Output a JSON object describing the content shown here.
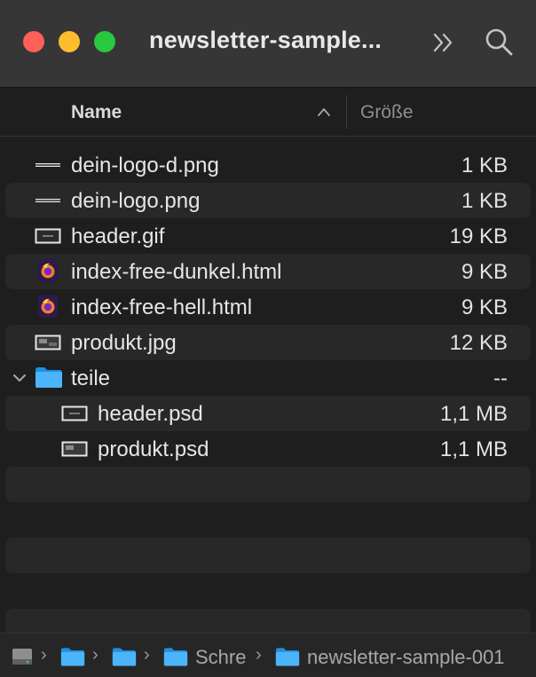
{
  "window": {
    "title": "newsletter-sample..."
  },
  "toolbar": {
    "more_icon": "chevron-double-right-icon",
    "search_icon": "search-icon"
  },
  "columns": {
    "name": "Name",
    "size": "Größe",
    "sort": "ascending"
  },
  "files": [
    {
      "name": "dein-logo-d.png",
      "size": "1 KB",
      "icon": "image-file-icon"
    },
    {
      "name": "dein-logo.png",
      "size": "1 KB",
      "icon": "image-file-icon"
    },
    {
      "name": "header.gif",
      "size": "19 KB",
      "icon": "image-file-icon"
    },
    {
      "name": "index-free-dunkel.html",
      "size": "9 KB",
      "icon": "firefox-html-icon"
    },
    {
      "name": "index-free-hell.html",
      "size": "9 KB",
      "icon": "firefox-html-icon"
    },
    {
      "name": "produkt.jpg",
      "size": "12 KB",
      "icon": "image-file-icon"
    },
    {
      "name": "teile",
      "size": "--",
      "icon": "folder-icon",
      "expanded": true
    },
    {
      "name": "header.psd",
      "size": "1,1 MB",
      "icon": "image-file-icon"
    },
    {
      "name": "produkt.psd",
      "size": "1,1 MB",
      "icon": "image-file-icon"
    }
  ],
  "pathbar": {
    "items": [
      {
        "label": "",
        "icon": "hard-drive-icon"
      },
      {
        "label": "",
        "icon": "folder-icon"
      },
      {
        "label": "",
        "icon": "folder-icon"
      },
      {
        "label": "Schre",
        "icon": "folder-icon"
      },
      {
        "label": "newsletter-sample-001",
        "icon": "folder-icon"
      }
    ],
    "separator": "›"
  },
  "colors": {
    "red": "#fe5f57",
    "yellow": "#febc2e",
    "green": "#28c840",
    "folder": "#39a9f5"
  }
}
